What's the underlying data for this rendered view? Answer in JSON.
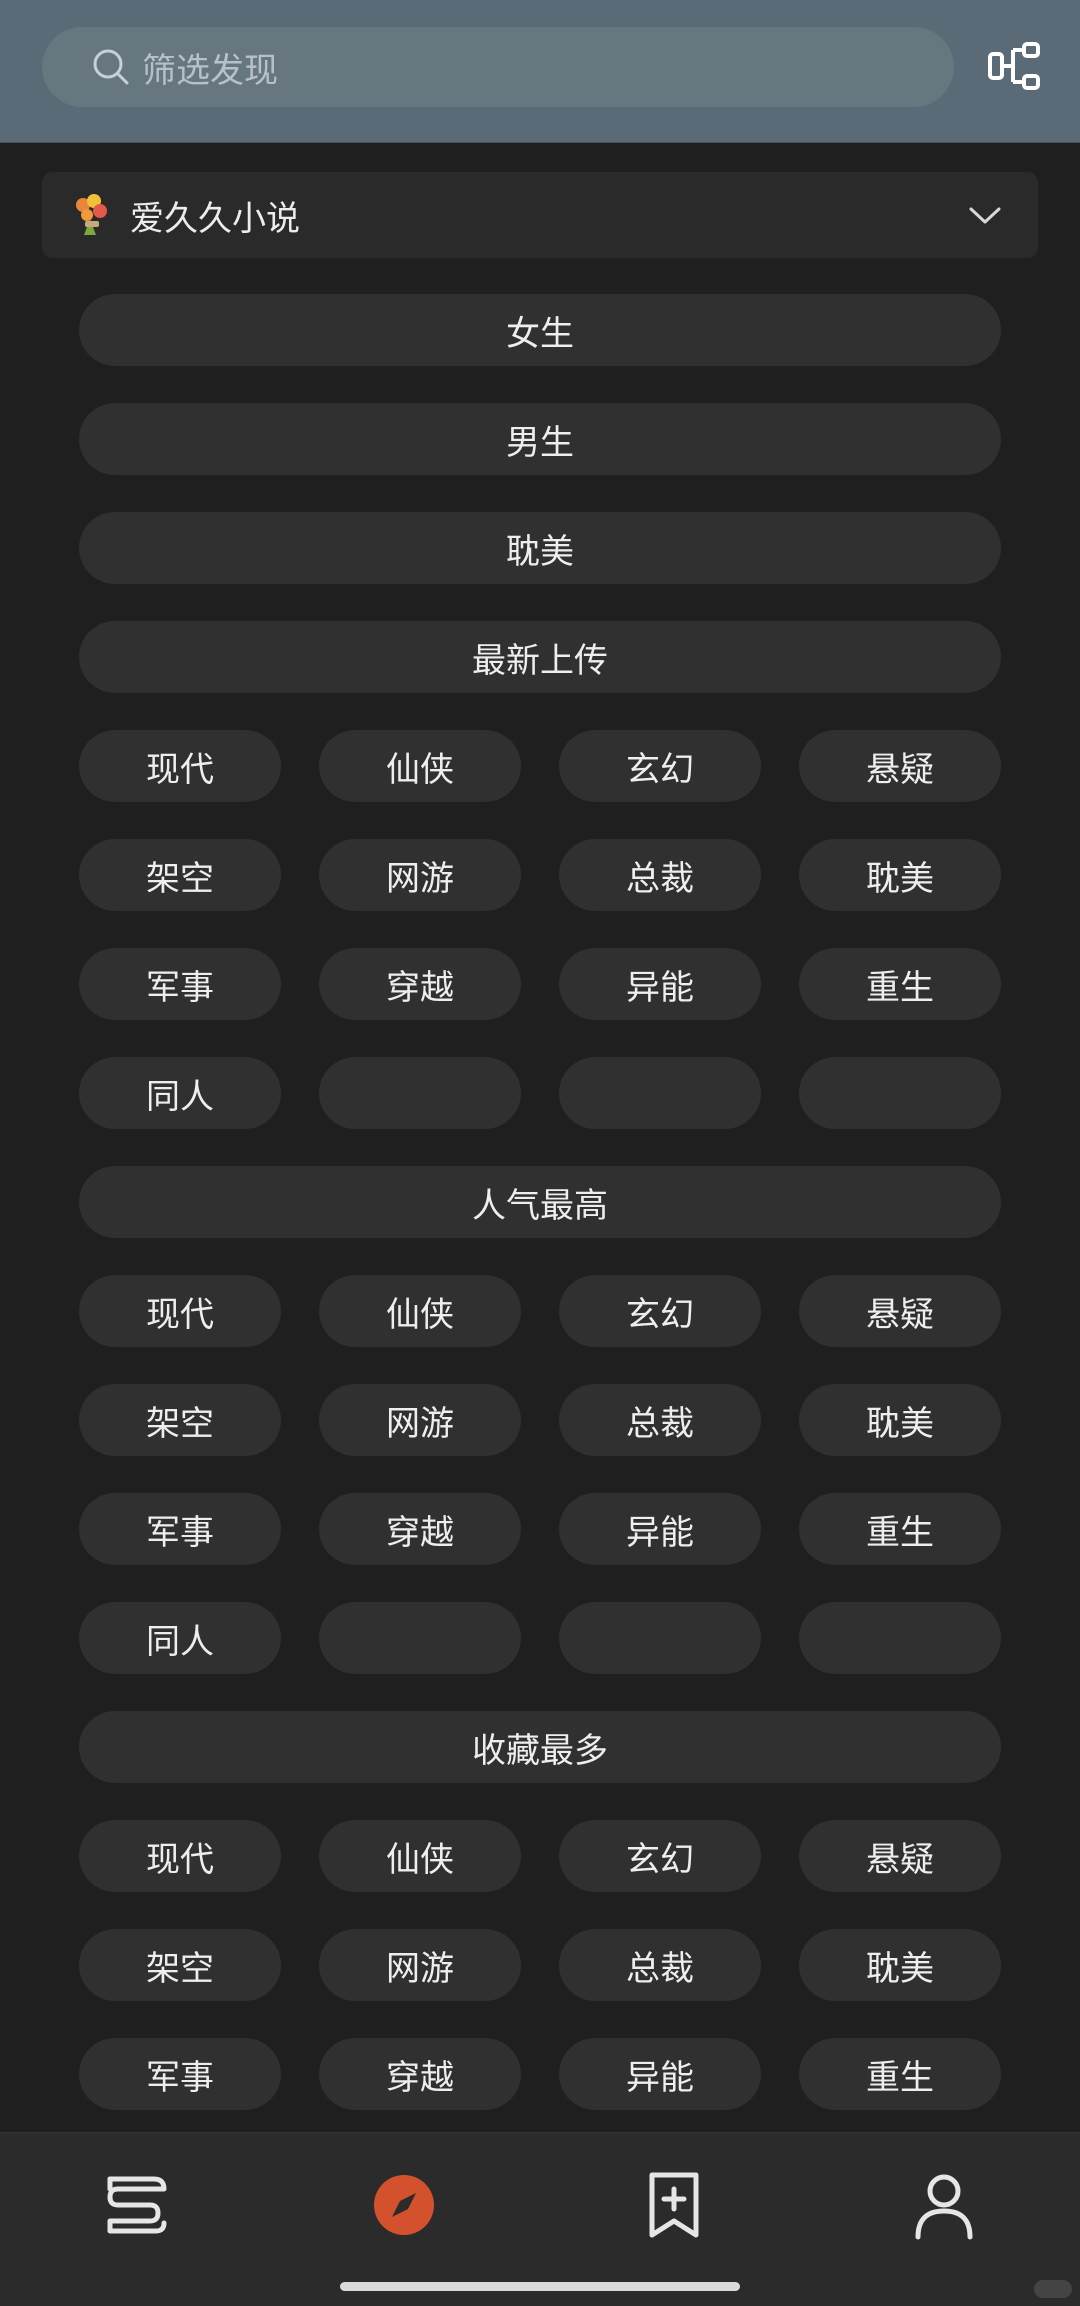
{
  "search": {
    "placeholder": "筛选发现"
  },
  "source": {
    "name": "爱久久小说"
  },
  "categories": [
    {
      "label": "女生"
    },
    {
      "label": "男生"
    },
    {
      "label": "耽美"
    }
  ],
  "sections": [
    {
      "title": "最新上传",
      "tags": [
        [
          "现代",
          "仙侠",
          "玄幻",
          "悬疑"
        ],
        [
          "架空",
          "网游",
          "总裁",
          "耽美"
        ],
        [
          "军事",
          "穿越",
          "异能",
          "重生"
        ],
        [
          "同人",
          "",
          "",
          ""
        ]
      ]
    },
    {
      "title": "人气最高",
      "tags": [
        [
          "现代",
          "仙侠",
          "玄幻",
          "悬疑"
        ],
        [
          "架空",
          "网游",
          "总裁",
          "耽美"
        ],
        [
          "军事",
          "穿越",
          "异能",
          "重生"
        ],
        [
          "同人",
          "",
          "",
          ""
        ]
      ]
    },
    {
      "title": "收藏最多",
      "tags": [
        [
          "现代",
          "仙侠",
          "玄幻",
          "悬疑"
        ],
        [
          "架空",
          "网游",
          "总裁",
          "耽美"
        ],
        [
          "军事",
          "穿越",
          "异能",
          "重生"
        ]
      ]
    }
  ],
  "nav": {
    "items": [
      {
        "icon": "bookshelf-icon"
      },
      {
        "icon": "compass-icon",
        "active": true
      },
      {
        "icon": "bookmark-add-icon"
      },
      {
        "icon": "user-icon"
      }
    ],
    "active_color": "#d4512e"
  }
}
